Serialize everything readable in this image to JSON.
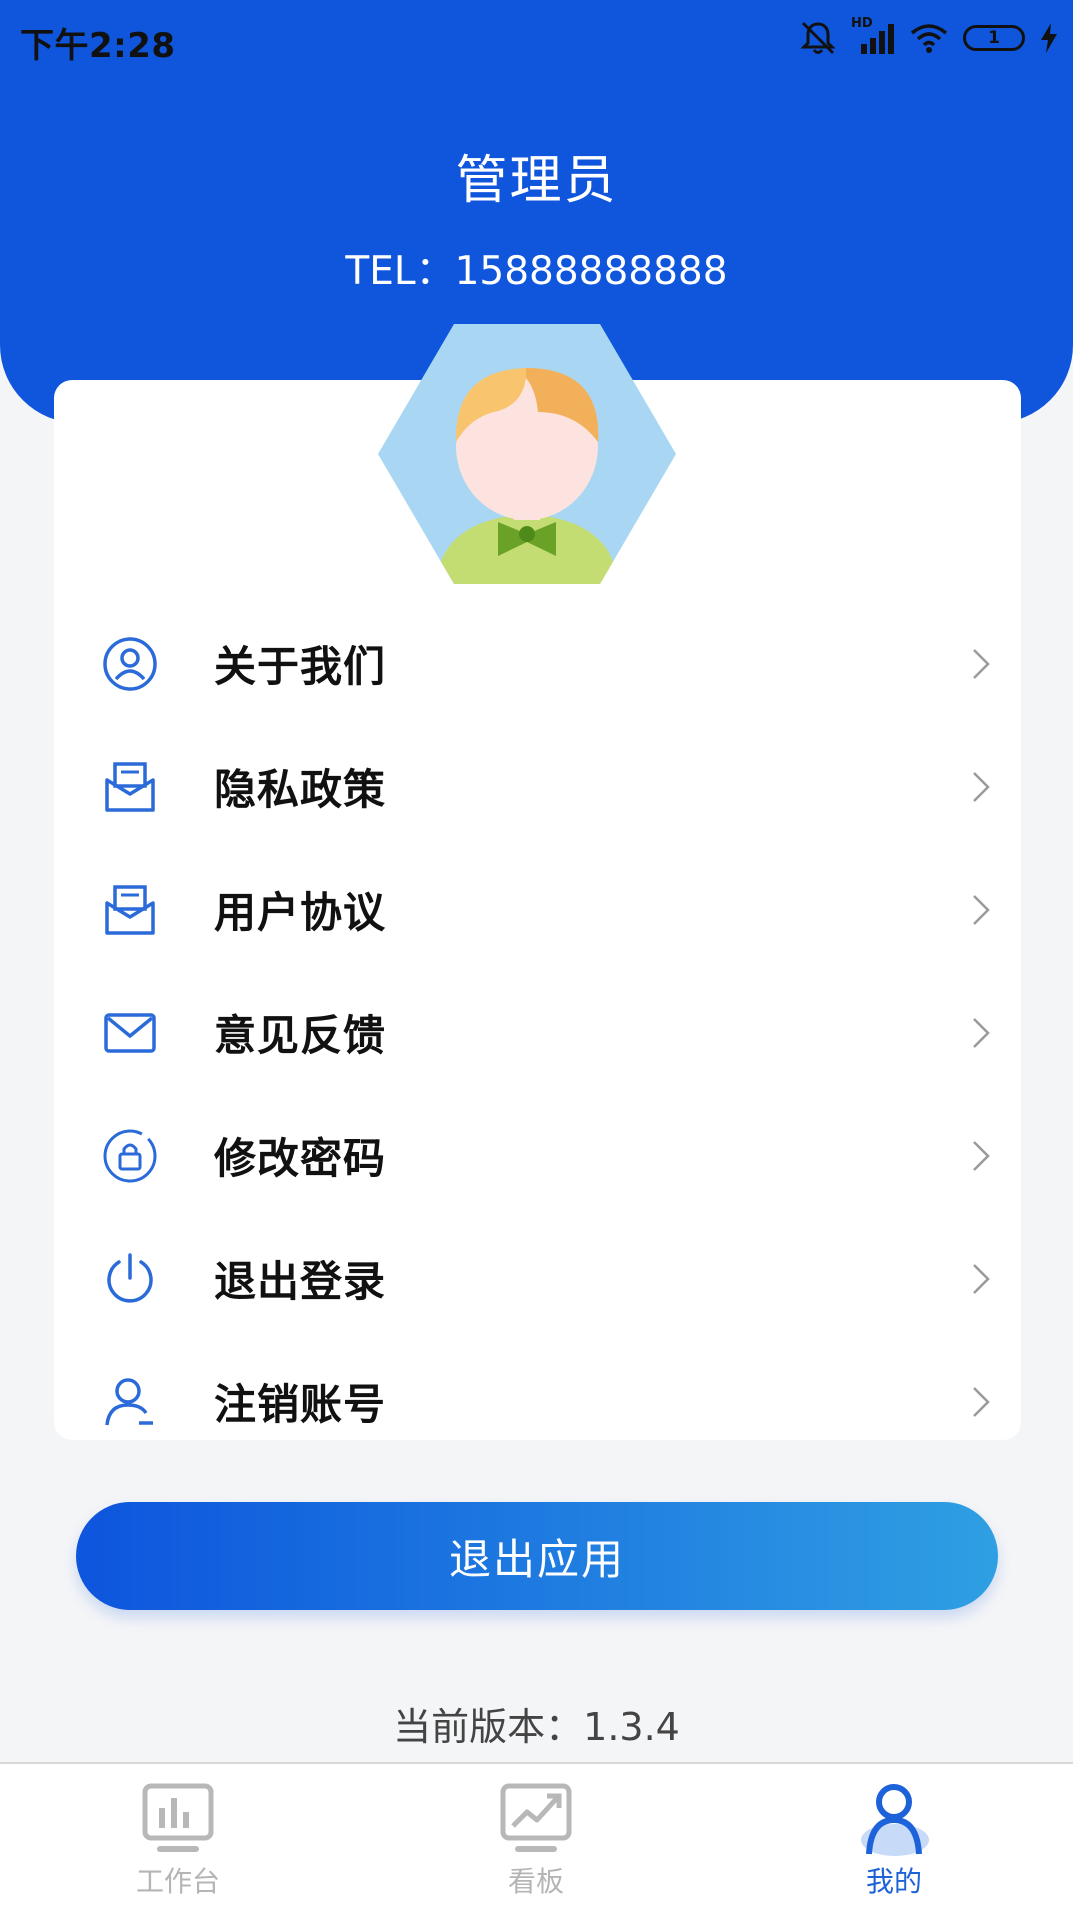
{
  "status_bar": {
    "time": "下午2:28",
    "network": "HD",
    "battery": "1"
  },
  "header": {
    "name": "管理员",
    "tel": "TEL：15888888888"
  },
  "menu": {
    "items": [
      {
        "label": "关于我们",
        "icon": "user-circle-icon"
      },
      {
        "label": "隐私政策",
        "icon": "document-envelope-icon"
      },
      {
        "label": "用户协议",
        "icon": "document-envelope-icon"
      },
      {
        "label": "意见反馈",
        "icon": "mail-icon"
      },
      {
        "label": "修改密码",
        "icon": "lock-icon"
      },
      {
        "label": "退出登录",
        "icon": "power-icon"
      },
      {
        "label": "注销账号",
        "icon": "user-minus-icon"
      }
    ]
  },
  "exit_button": {
    "label": "退出应用"
  },
  "version": "当前版本：1.3.4",
  "tabbar": {
    "tabs": [
      {
        "label": "工作台",
        "icon": "dashboard-chart-icon",
        "active": false
      },
      {
        "label": "看板",
        "icon": "trend-board-icon",
        "active": false
      },
      {
        "label": "我的",
        "icon": "person-icon",
        "active": true
      }
    ]
  },
  "colors": {
    "header_blue": "#0f56dc",
    "accent": "#1d62d8",
    "button_gradient_start": "#0d55dd",
    "button_gradient_end": "#2f9fe3"
  }
}
